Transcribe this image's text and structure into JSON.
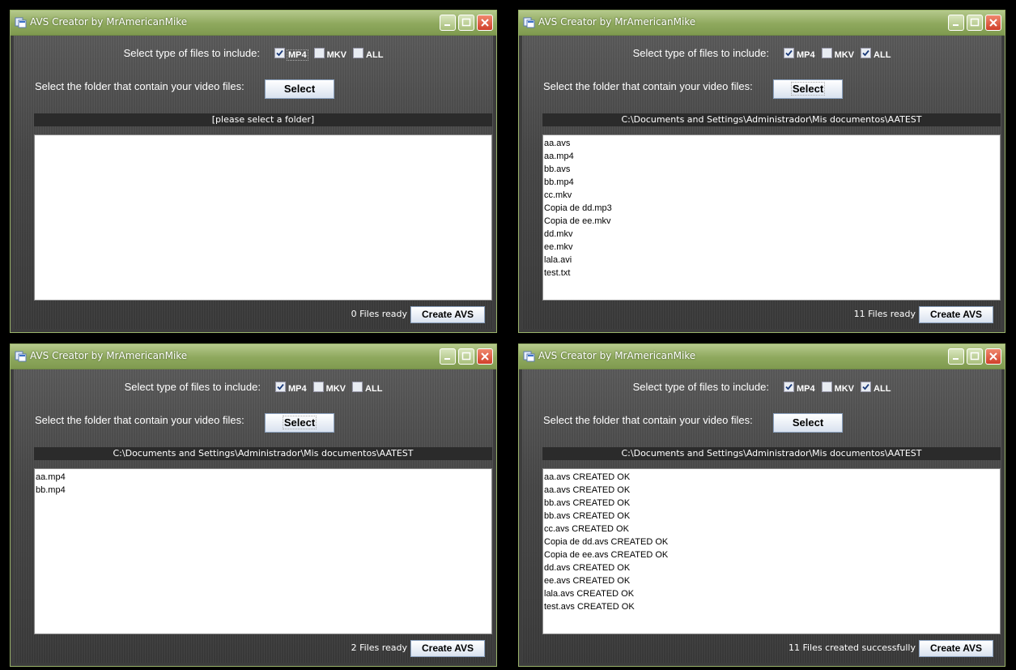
{
  "colors": {
    "titlebar": "#8ea85d",
    "close_button": "#d0402a",
    "path_bar": "#2b2b2b"
  },
  "windows": [
    {
      "title": "AVS Creator by MrAmericanMike",
      "type_label": "Select type of files to include:",
      "checkboxes": [
        {
          "label": "MP4",
          "checked": true
        },
        {
          "label": "MKV",
          "checked": false
        },
        {
          "label": "ALL",
          "checked": false
        }
      ],
      "folder_label": "Select the folder that contain your video files:",
      "select_button": "Select",
      "path": "[please select a folder]",
      "files": [],
      "status": "0 Files ready",
      "create_button": "Create AVS"
    },
    {
      "title": "AVS Creator by MrAmericanMike",
      "type_label": "Select type of files to include:",
      "checkboxes": [
        {
          "label": "MP4",
          "checked": true
        },
        {
          "label": "MKV",
          "checked": false
        },
        {
          "label": "ALL",
          "checked": true
        }
      ],
      "folder_label": "Select the folder that contain your video files:",
      "select_button": "Select",
      "path": "C:\\Documents and Settings\\Administrador\\Mis documentos\\AATEST",
      "files": [
        "aa.avs",
        "aa.mp4",
        "bb.avs",
        "bb.mp4",
        "cc.mkv",
        "Copia de dd.mp3",
        "Copia de ee.mkv",
        "dd.mkv",
        "ee.mkv",
        "lala.avi",
        "test.txt"
      ],
      "status": "11 Files ready",
      "create_button": "Create AVS"
    },
    {
      "title": "AVS Creator by MrAmericanMike",
      "type_label": "Select type of files to include:",
      "checkboxes": [
        {
          "label": "MP4",
          "checked": true
        },
        {
          "label": "MKV",
          "checked": false
        },
        {
          "label": "ALL",
          "checked": false
        }
      ],
      "folder_label": "Select the folder that contain your video files:",
      "select_button": "Select",
      "path": "C:\\Documents and Settings\\Administrador\\Mis documentos\\AATEST",
      "files": [
        "aa.mp4",
        "bb.mp4"
      ],
      "status": "2 Files ready",
      "create_button": "Create AVS"
    },
    {
      "title": "AVS Creator by MrAmericanMike",
      "type_label": "Select type of files to include:",
      "checkboxes": [
        {
          "label": "MP4",
          "checked": true
        },
        {
          "label": "MKV",
          "checked": false
        },
        {
          "label": "ALL",
          "checked": true
        }
      ],
      "folder_label": "Select the folder that contain your video files:",
      "select_button": "Select",
      "path": "C:\\Documents and Settings\\Administrador\\Mis documentos\\AATEST",
      "files": [
        "aa.avs CREATED OK",
        "aa.avs CREATED OK",
        "bb.avs CREATED OK",
        "bb.avs CREATED OK",
        "cc.avs CREATED OK",
        "Copia de dd.avs CREATED OK",
        "Copia de ee.avs CREATED OK",
        "dd.avs CREATED OK",
        "ee.avs CREATED OK",
        "lala.avs CREATED OK",
        "test.avs CREATED OK"
      ],
      "status": "11 Files created successfully",
      "create_button": "Create AVS"
    }
  ]
}
